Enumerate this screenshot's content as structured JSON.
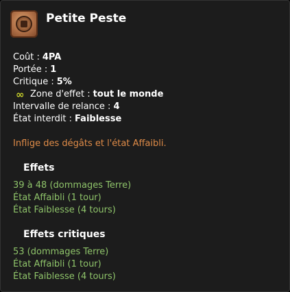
{
  "spell": {
    "name": "Petite Peste",
    "icon": "spell-emblem-icon"
  },
  "stats": {
    "cost_label": "Coût :",
    "cost_value": "4PA",
    "range_label": "Portée :",
    "range_value": "1",
    "critical_label": "Critique :",
    "critical_value": "5%",
    "zone_label": "Zone d'effet :",
    "zone_value": "tout le monde",
    "zone_icon": "infinity-icon",
    "cooldown_label": "Intervalle de relance :",
    "cooldown_value": "4",
    "forbidden_state_label": "État interdit :",
    "forbidden_state_value": "Faiblesse"
  },
  "description": "Inflige des dégâts et l'état Affaibli.",
  "effects": {
    "header": "Effets",
    "items": [
      "39 à 48 (dommages Terre)",
      "État Affaibli (1 tour)",
      "État Faiblesse (4 tours)"
    ]
  },
  "critical_effects": {
    "header": "Effets critiques",
    "items": [
      "53 (dommages Terre)",
      "État Affaibli (1 tour)",
      "État Faiblesse (4 tours)"
    ]
  },
  "colors": {
    "background": "#1c1c1c",
    "text": "#ffffff",
    "description": "#e08c48",
    "effect": "#8fc46a",
    "zone_icon": "#c9d22c"
  }
}
